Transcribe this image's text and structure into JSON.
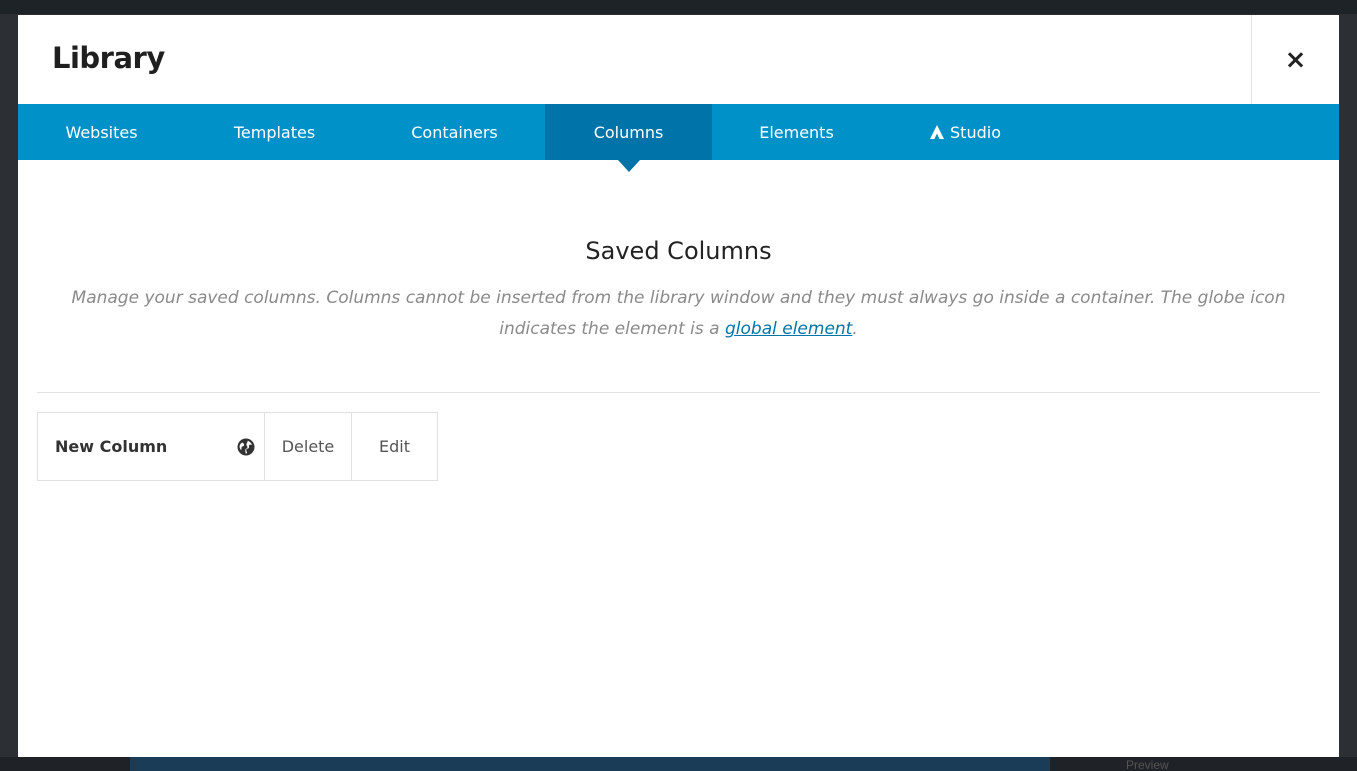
{
  "modal": {
    "title": "Library",
    "close_glyph": "×"
  },
  "tabs": [
    {
      "label": "Websites",
      "active": false
    },
    {
      "label": "Templates",
      "active": false
    },
    {
      "label": "Containers",
      "active": false
    },
    {
      "label": "Columns",
      "active": true
    },
    {
      "label": "Elements",
      "active": false
    },
    {
      "label": "Studio",
      "active": false,
      "icon": "avada-studio-icon"
    }
  ],
  "content": {
    "title": "Saved Columns",
    "description_before": "Manage your saved columns. Columns cannot be inserted from the library window and they must always go inside a container. The globe icon indicates the element is a ",
    "description_link": "global element",
    "description_after": "."
  },
  "saved_items": [
    {
      "name": "New Column",
      "global": true,
      "icon": "globe-icon",
      "delete_label": "Delete",
      "edit_label": "Edit"
    }
  ],
  "background": {
    "preview_label": "Preview"
  },
  "colors": {
    "tab_bar": "#0091c8",
    "tab_active": "#0074a8",
    "link": "#0074a8"
  }
}
